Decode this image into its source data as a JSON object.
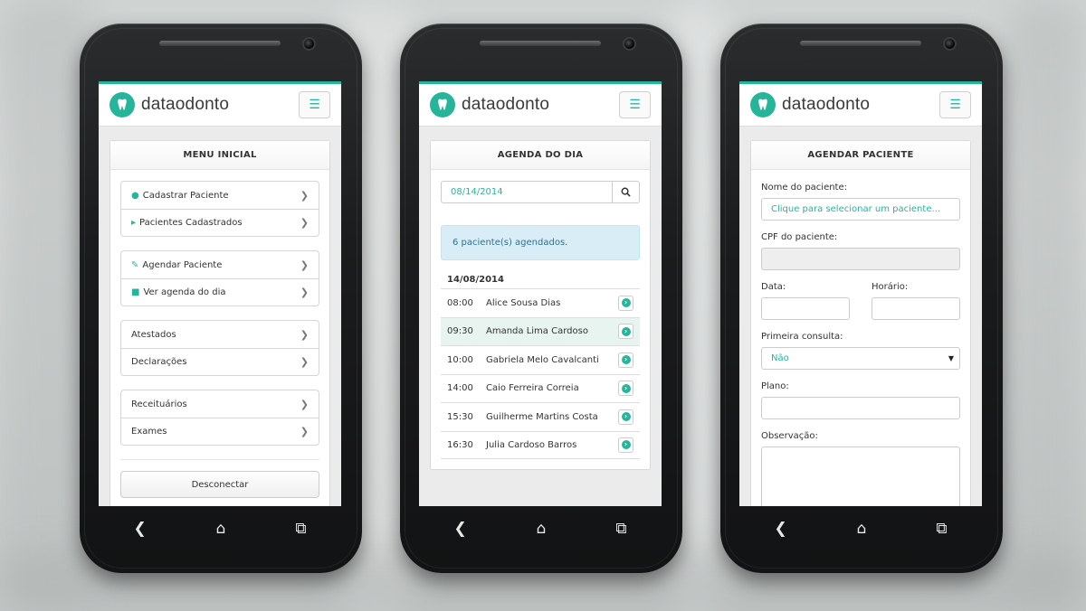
{
  "brand": {
    "name": "dataodonto",
    "accent_color": "#26b59b"
  },
  "screen_menu": {
    "panel_title": "MENU INICIAL",
    "groups": [
      [
        {
          "label": "Cadastrar Paciente",
          "icon": "user-icon"
        },
        {
          "label": "Pacientes Cadastrados",
          "icon": "folder-open-icon"
        }
      ],
      [
        {
          "label": "Agendar Paciente",
          "icon": "edit-icon"
        },
        {
          "label": "Ver agenda do dia",
          "icon": "book-icon"
        }
      ],
      [
        {
          "label": "Atestados",
          "icon": ""
        },
        {
          "label": "Declarações",
          "icon": ""
        }
      ],
      [
        {
          "label": "Receituários",
          "icon": ""
        },
        {
          "label": "Exames",
          "icon": ""
        }
      ]
    ],
    "logout_label": "Desconectar"
  },
  "screen_agenda": {
    "panel_title": "AGENDA DO DIA",
    "date_value": "08/14/2014",
    "alert_text": "6 paciente(s) agendados.",
    "day_title": "14/08/2014",
    "appointments": [
      {
        "time": "08:00",
        "name": "Alice Sousa Dias"
      },
      {
        "time": "09:30",
        "name": "Amanda Lima Cardoso"
      },
      {
        "time": "10:00",
        "name": "Gabriela Melo Cavalcanti"
      },
      {
        "time": "14:00",
        "name": "Caio Ferreira Correia"
      },
      {
        "time": "15:30",
        "name": "Guilherme Martins Costa"
      },
      {
        "time": "16:30",
        "name": "Julia Cardoso Barros"
      }
    ]
  },
  "screen_form": {
    "panel_title": "AGENDAR PACIENTE",
    "patient_label": "Nome do paciente:",
    "patient_value": "Clique para selecionar um paciente...",
    "cpf_label": "CPF do paciente:",
    "date_label": "Data:",
    "time_label": "Horário:",
    "first_visit_label": "Primeira consulta:",
    "first_visit_value": "Não",
    "plan_label": "Plano:",
    "notes_label": "Observação:"
  }
}
